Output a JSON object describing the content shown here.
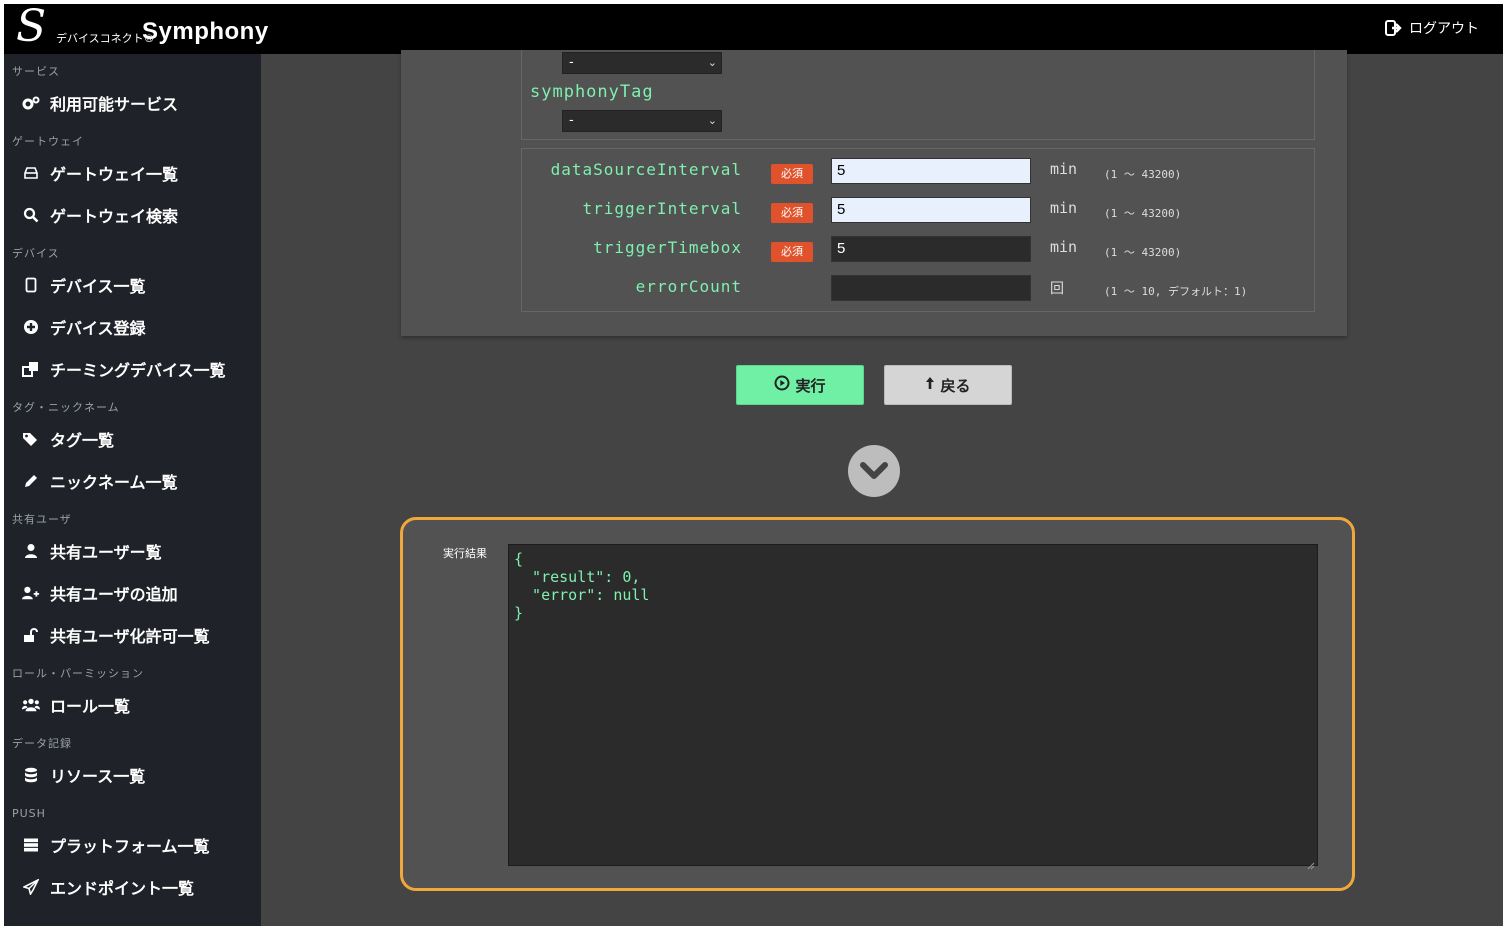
{
  "header": {
    "logo_mark": "S",
    "logo_sub": "デバイスコネクト®",
    "brand": "Symphony",
    "logout_label": "ログアウト"
  },
  "sidebar": {
    "sections": [
      {
        "title": "サービス",
        "items": [
          {
            "label": "利用可能サービス",
            "icon": "cogs-icon"
          }
        ]
      },
      {
        "title": "ゲートウェイ",
        "items": [
          {
            "label": "ゲートウェイ一覧",
            "icon": "hdd-icon"
          },
          {
            "label": "ゲートウェイ検索",
            "icon": "search-icon"
          }
        ]
      },
      {
        "title": "デバイス",
        "items": [
          {
            "label": "デバイス一覧",
            "icon": "tablet-icon"
          },
          {
            "label": "デバイス登録",
            "icon": "plus-circle-icon"
          },
          {
            "label": "チーミングデバイス一覧",
            "icon": "clone-icon"
          }
        ]
      },
      {
        "title": "タグ・ニックネーム",
        "items": [
          {
            "label": "タグ一覧",
            "icon": "tags-icon"
          },
          {
            "label": "ニックネーム一覧",
            "icon": "pencil-icon"
          }
        ]
      },
      {
        "title": "共有ユーザ",
        "items": [
          {
            "label": "共有ユーザー覧",
            "icon": "user-icon"
          },
          {
            "label": "共有ユーザの追加",
            "icon": "user-plus-icon"
          },
          {
            "label": "共有ユーザ化許可一覧",
            "icon": "unlock-icon"
          }
        ]
      },
      {
        "title": "ロール・パーミッション",
        "items": [
          {
            "label": "ロール一覧",
            "icon": "users-icon"
          }
        ]
      },
      {
        "title": "データ記録",
        "items": [
          {
            "label": "リソース一覧",
            "icon": "database-icon"
          }
        ]
      },
      {
        "title": "PUSH",
        "items": [
          {
            "label": "プラットフォーム一覧",
            "icon": "server-icon"
          },
          {
            "label": "エンドポイント一覧",
            "icon": "paper-plane-icon"
          }
        ]
      }
    ]
  },
  "form": {
    "select_top_value": "-",
    "tag_label": "symphonyTag",
    "tag_select_value": "-",
    "required_badge": "必須",
    "fields": [
      {
        "label": "dataSourceInterval",
        "required": true,
        "value": "5",
        "unit": "min",
        "range": "(1 ～ 43200)"
      },
      {
        "label": "triggerInterval",
        "required": true,
        "value": "5",
        "unit": "min",
        "range": "(1 ～ 43200)"
      },
      {
        "label": "triggerTimebox",
        "required": true,
        "value": "5",
        "unit": "min",
        "range": "(1 ～ 43200)"
      },
      {
        "label": "errorCount",
        "required": false,
        "value": "",
        "unit": "回",
        "range": "(1 ～ 10, デフォルト：1)"
      }
    ]
  },
  "buttons": {
    "execute_label": "実行",
    "back_label": "戻る"
  },
  "result": {
    "label": "実行結果",
    "text": "{\n  \"result\": 0,\n  \"error\": null\n}"
  },
  "colors": {
    "accent_green": "#6ff0a4",
    "code_green": "#7ff0b0",
    "required_red": "#e0522c",
    "highlight_orange": "#f0a83a"
  }
}
